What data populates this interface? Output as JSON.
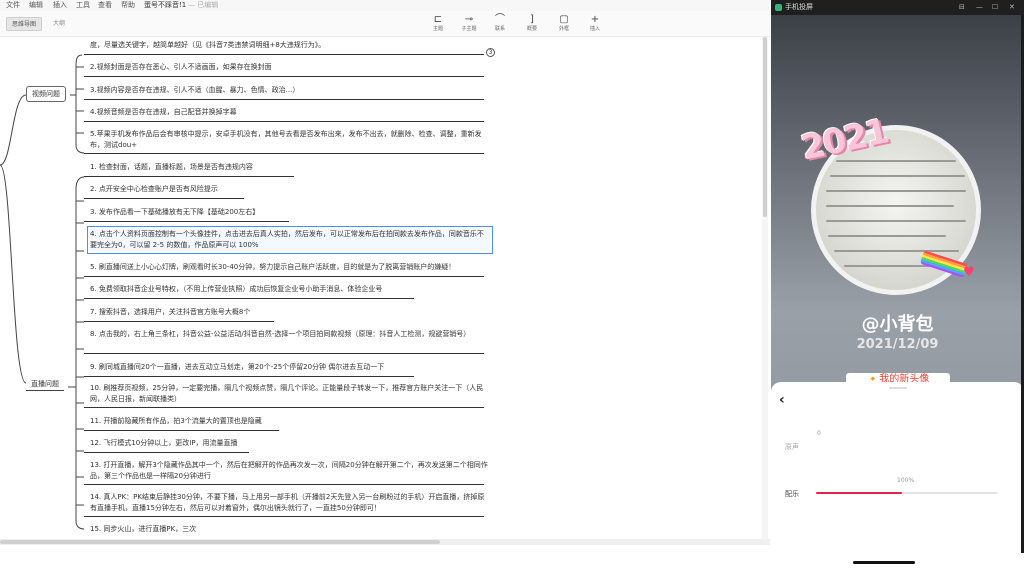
{
  "menubar": {
    "items": [
      "文件",
      "编辑",
      "插入",
      "工具",
      "查看",
      "帮助"
    ],
    "doc_title": "蛋号不踩音!1",
    "save_status": "— 已编辑"
  },
  "toolbar": {
    "view_tabs": [
      "思维导图",
      "大纲"
    ],
    "tools": [
      {
        "label": "主题",
        "icon": "topic-icon"
      },
      {
        "label": "子主题",
        "icon": "subtopic-icon"
      },
      {
        "label": "联系",
        "icon": "relationship-icon"
      },
      {
        "label": "概要",
        "icon": "summary-icon"
      },
      {
        "label": "外框",
        "icon": "boundary-icon"
      },
      {
        "label": "插入",
        "icon": "plus-icon"
      }
    ]
  },
  "mindmap": {
    "branches": [
      {
        "label": "视频问题"
      },
      {
        "label": "直播问题"
      }
    ],
    "video_items": [
      "度，尽量选关键字，越简单越好（见《抖音7类违禁词明细+8大违规行为》。",
      "2.视频封面是否存在恶心、引人不适画面，如果存在换封面",
      "3.视频内容是否存在违规、引人不适（血腥、暴力、色情、政治...）",
      "4.视频音频是否存在违规，自己配音并换掉字幕",
      "5.苹果手机发布作品后会有审核中提示，安卓手机没有，其他号去看是否发布出来，发布不出去，就删除、检查、调整，重新发布，测试dou+"
    ],
    "live_items": [
      "1. 检查封面，话题，直播标题，场景是否有违规内容",
      "2. 点开安全中心检查账户是否有风险提示",
      "3. 发布作品看一下基础播放有无下降【基础200左右】",
      "4. 点击个人资料页面控制有一个头像挂件，点击进去后真人实拍，然后发布，可以正常发布后在拍同款去发布作品，同款音乐不要完全为0，可以留 2-5 的数值，作品原声可以 100%",
      "5. 刷直播间送上小心心灯牌，刷观看时长30-40分钟，努力提示自己账户活跃度，目的就是为了脱离营销账户的嫌疑！",
      "6. 免费领取抖音企业号特权，（不用上传营业执照）成功后恢复企业号小助手消息、体验企业号",
      "7. 搜索抖音，选择用户，关注抖音官方账号大概8个",
      "8. 点击我的，右上角三条杠，抖音公益-公益活动/抖音自然-选择一个项目拍同款视频（原理：抖音人工检测，规避营销号）",
      "9. 刷同城直播间20个一直播，进去互动立马划走，第20个-25个停留20分钟  偶尔进去互动一下",
      "10. 刷推荐页视频，25分钟，一定要完播，隔几个视频点赞，隔几个评论。正能量段子转发一下，推荐官方账户关注一下（人民网，人民日报，新闻联播类）",
      "11. 开播前隐藏所有作品，拍3个流量大的置顶也是隐藏",
      "12. 飞行模式10分钟以上，更改IP，用流量直播",
      "13. 打开直播，解开3个隐藏作品其中一个，然后在把解开的作品再次发一次，间隔20分钟在解开第二个，再次发送第二个相同作品，第三个作品也是一样隔20分钟进行",
      "14. 真人PK：PK结束后静挂30分钟，不要下播，马上用另一部手机（开播前2天先登入另一台刷粉过的手机）开启直播，挤掉原有直播手机，直播15分钟左右，然后可以对着窗外，偶尔出镜头就行了，一直挂50分钟即可！",
      "15. 同步火山，进行直播PK，三次"
    ],
    "collapse_symbol": "3"
  },
  "phone": {
    "window_title": "手机投屏",
    "window_controls": [
      "pin-icon",
      "minimize-icon",
      "maximize-icon",
      "close-icon"
    ],
    "sticker_text": "2021",
    "username": "@小背包",
    "date": "2021/12/09",
    "caption": "🔸我的新头像",
    "sheet": {
      "back_icon": "chevron-left-icon",
      "original_sound": {
        "label": "原声",
        "value_text": "0",
        "value": 0
      },
      "music": {
        "label": "配乐",
        "value_text": "100%",
        "value": 100
      }
    }
  },
  "colors": {
    "accent_selection": "#4a90e2",
    "slider_fill": "#e5244c",
    "caption_text": "#e8442e"
  }
}
